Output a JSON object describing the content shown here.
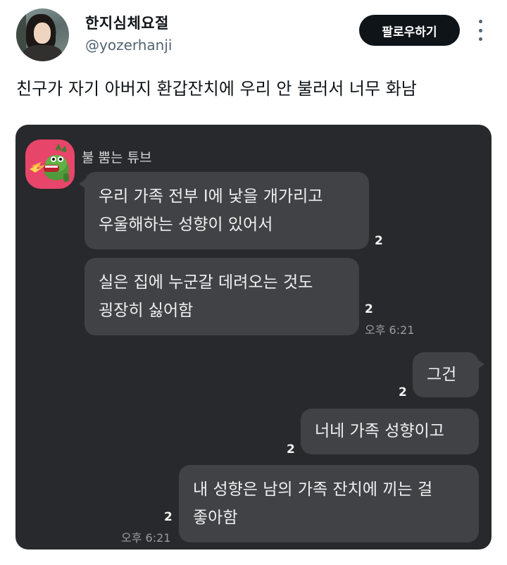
{
  "header": {
    "display_name": "한지심체요절",
    "handle": "@yozerhanji",
    "follow_label": "팔로우하기"
  },
  "tweet": {
    "text": "친구가 자기 아버지 환갑잔치에 우리 안 불러서 너무 화남"
  },
  "chat": {
    "sender": "불 뿜는 튜브",
    "messages": [
      {
        "side": "left",
        "lines": [
          "우리 가족 전부 I에 낯을 개가리고",
          "우울해하는 성향이 있어서"
        ],
        "unread": "2",
        "time": ""
      },
      {
        "side": "left",
        "lines": [
          "실은 집에 누군갈 데려오는 것도",
          "굉장히 싫어함"
        ],
        "unread": "2",
        "time": "오후 6:21"
      },
      {
        "side": "right",
        "lines": [
          "그건"
        ],
        "unread": "2",
        "time": ""
      },
      {
        "side": "right",
        "lines": [
          "너네 가족 성향이고"
        ],
        "unread": "2",
        "time": ""
      },
      {
        "side": "right",
        "lines": [
          "내 성향은 남의 가족 잔치에 끼는 걸",
          "좋아함"
        ],
        "unread": "2",
        "time": "오후 6:21"
      }
    ]
  },
  "colors": {
    "chat_background": "#28292c",
    "bubble": "#414246",
    "follow_button": "#0f1419",
    "profile_pic": "#e8456a"
  }
}
